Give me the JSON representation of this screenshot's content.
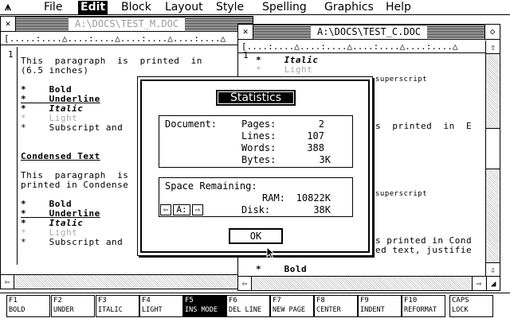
{
  "menubar": {
    "logo": "⩚",
    "items": [
      {
        "label": "File"
      },
      {
        "label": "Edit",
        "active": true
      },
      {
        "label": "Block"
      },
      {
        "label": "Layout"
      },
      {
        "label": "Style"
      },
      {
        "label": "Spelling"
      },
      {
        "label": "Graphics"
      },
      {
        "label": "Help"
      }
    ]
  },
  "window_back": {
    "title": "A:\\DOCS\\TEST_M.DOC",
    "line_number": "1",
    "lines": [
      "This  paragraph  is  printed  in",
      "(6.5 inches)",
      "*    Bold",
      "*    Underline",
      "*    Italic",
      "*    Light",
      "*    Subscript and",
      "Condensed Text",
      "This  paragraph  is",
      "printed in Condense",
      "*    Bold",
      "*    Underline",
      "*    Italic",
      "*    Light",
      "*    Subscript and"
    ]
  },
  "window_front": {
    "title": "A:\\DOCS\\TEST_C.DOC",
    "line_number": "1",
    "lines": [
      "*    Italic",
      "*    Light",
      "superscript",
      "s  printed  in  E",
      "superscript",
      "s printed in Cond",
      "ed text, justifie",
      "*    Bold"
    ]
  },
  "dialog": {
    "title": "Statistics",
    "document_label": "Document:",
    "pages_label": "Pages:",
    "pages_value": "2",
    "lines_label": "Lines:",
    "lines_value": "107",
    "words_label": "Words:",
    "words_value": "388",
    "bytes_label": "Bytes:",
    "bytes_value": "3K",
    "space_label": "Space Remaining:",
    "ram_label": "RAM:",
    "ram_value": "10822K",
    "disk_label": "Disk:",
    "disk_value": "38K",
    "drive_prev": "⇦",
    "drive_value": "A:",
    "drive_next": "⇨",
    "ok_label": "OK"
  },
  "fkeys": [
    {
      "num": "F1",
      "label": "BOLD"
    },
    {
      "num": "F2",
      "label": "UNDER"
    },
    {
      "num": "F3",
      "label": "ITALIC"
    },
    {
      "num": "F4",
      "label": "LIGHT"
    },
    {
      "num": "F5",
      "label": "INS MODE",
      "active": true
    },
    {
      "num": "F6",
      "label": "DEL LINE"
    },
    {
      "num": "F7",
      "label": "NEW PAGE"
    },
    {
      "num": "F8",
      "label": "CENTER"
    },
    {
      "num": "F9",
      "label": "INDENT"
    },
    {
      "num": "F10",
      "label": "REFORMAT"
    },
    {
      "num": "CAPS",
      "label": "LOCK"
    }
  ]
}
